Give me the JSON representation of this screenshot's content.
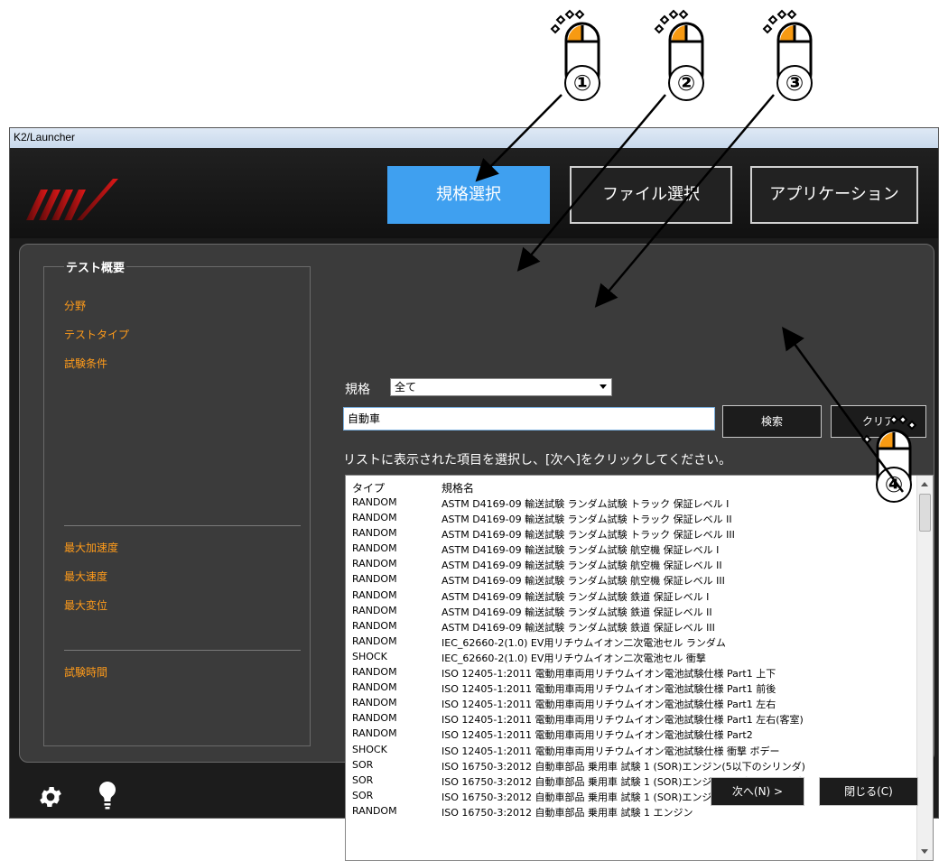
{
  "window": {
    "title": "K2/Launcher"
  },
  "callouts": [
    "①",
    "②",
    "③",
    "④"
  ],
  "header": {
    "tabs": [
      {
        "label": "規格選択",
        "active": true
      },
      {
        "label": "ファイル選択",
        "active": false
      },
      {
        "label": "アプリケーション",
        "active": false
      }
    ]
  },
  "summary": {
    "title": "テスト概要",
    "items_top": [
      "分野",
      "テストタイプ",
      "試験条件"
    ],
    "items_mid": [
      "最大加速度",
      "最大速度",
      "最大変位"
    ],
    "items_bottom": [
      "試験時間"
    ]
  },
  "filter": {
    "label": "規格",
    "selected": "全て",
    "search_value": "自動車",
    "search_button": "検索",
    "clear_button": "クリア"
  },
  "instruction": "リストに表示された項目を選択し、[次へ]をクリックしてください。",
  "table": {
    "columns": [
      "タイプ",
      "規格名"
    ],
    "rows": [
      [
        "RANDOM",
        "ASTM D4169-09 輸送試験 ランダム試験 トラック 保証レベル I"
      ],
      [
        "RANDOM",
        "ASTM D4169-09 輸送試験 ランダム試験 トラック 保証レベル II"
      ],
      [
        "RANDOM",
        "ASTM D4169-09 輸送試験 ランダム試験 トラック 保証レベル III"
      ],
      [
        "RANDOM",
        "ASTM D4169-09 輸送試験 ランダム試験 航空機 保証レベル I"
      ],
      [
        "RANDOM",
        "ASTM D4169-09 輸送試験 ランダム試験 航空機 保証レベル II"
      ],
      [
        "RANDOM",
        "ASTM D4169-09 輸送試験 ランダム試験 航空機 保証レベル III"
      ],
      [
        "RANDOM",
        "ASTM D4169-09 輸送試験 ランダム試験 鉄道 保証レベル I"
      ],
      [
        "RANDOM",
        "ASTM D4169-09 輸送試験 ランダム試験 鉄道 保証レベル II"
      ],
      [
        "RANDOM",
        "ASTM D4169-09 輸送試験 ランダム試験 鉄道 保証レベル III"
      ],
      [
        "RANDOM",
        "IEC_62660-2(1.0) EV用リチウムイオン二次電池セル ランダム"
      ],
      [
        "SHOCK",
        "IEC_62660-2(1.0) EV用リチウムイオン二次電池セル 衝撃"
      ],
      [
        "RANDOM",
        "ISO 12405-1:2011 電動用車両用リチウムイオン電池試験仕様 Part1 上下"
      ],
      [
        "RANDOM",
        "ISO 12405-1:2011 電動用車両用リチウムイオン電池試験仕様 Part1 前後"
      ],
      [
        "RANDOM",
        "ISO 12405-1:2011 電動用車両用リチウムイオン電池試験仕様 Part1 左右"
      ],
      [
        "RANDOM",
        "ISO 12405-1:2011 電動用車両用リチウムイオン電池試験仕様 Part1 左右(客室)"
      ],
      [
        "RANDOM",
        "ISO 12405-1:2011 電動用車両用リチウムイオン電池試験仕様 Part2"
      ],
      [
        "SHOCK",
        "ISO 12405-1:2011 電動用車両用リチウムイオン電池試験仕様 衝撃 ボデー"
      ],
      [
        "SOR",
        "ISO 16750-3:2012 自動車部品 乗用車 試験 1 (SOR)エンジン(5以下のシリンダ)"
      ],
      [
        "SOR",
        "ISO 16750-3:2012 自動車部品 乗用車 試験 1 (SOR)エンジン(6以上のシリンダ)"
      ],
      [
        "SOR",
        "ISO 16750-3:2012 自動車部品 乗用車 試験 1 (SOR)エンジン(全てのシリンダ)"
      ],
      [
        "RANDOM",
        "ISO 16750-3:2012 自動車部品 乗用車 試験 1 エンジン"
      ]
    ]
  },
  "footer": {
    "next_button": "次へ(N) >",
    "close_button": "閉じる(C)",
    "icons": [
      "gear-icon",
      "lightbulb-icon"
    ]
  },
  "colors": {
    "accent": "#3fa0f0",
    "orange": "#ff9b1a",
    "callout_fill": "#f79a12"
  }
}
